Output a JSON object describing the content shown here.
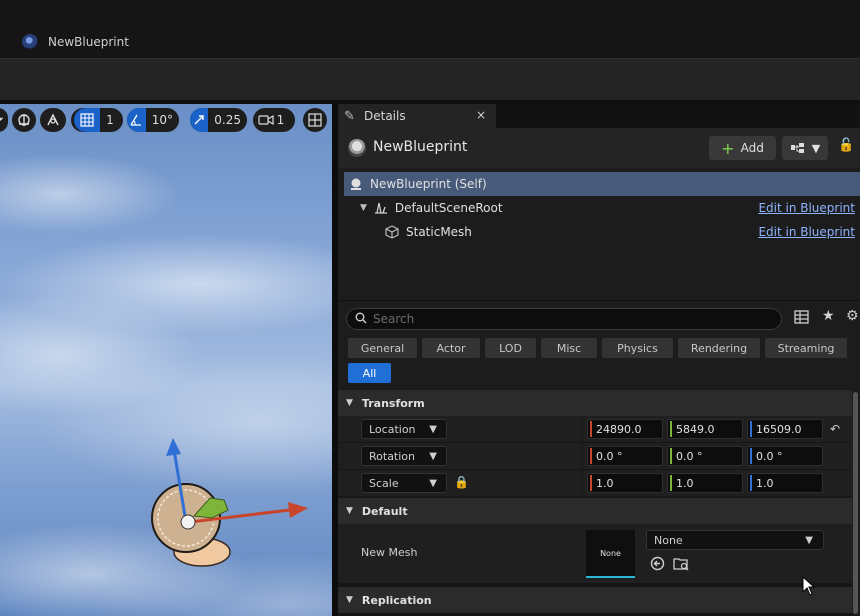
{
  "window": {
    "title": "NewBlueprint"
  },
  "viewport": {
    "grid_snap": "1",
    "angle_snap": "10°",
    "scale_snap": "0.25",
    "camera_speed": "1"
  },
  "details": {
    "tab_label": "Details",
    "tab_close": "×",
    "header_title": "NewBlueprint",
    "add_label": "Add",
    "components": [
      {
        "label": "NewBlueprint (Self)",
        "link": ""
      },
      {
        "label": "DefaultSceneRoot",
        "link": "Edit in Blueprint"
      },
      {
        "label": "StaticMesh",
        "link": "Edit in Blueprint"
      }
    ],
    "search_placeholder": "Search",
    "filters": [
      "General",
      "Actor",
      "LOD",
      "Misc",
      "Physics",
      "Rendering",
      "Streaming",
      "All"
    ],
    "active_filter": "All",
    "sections": {
      "transform": "Transform",
      "default": "Default",
      "replication": "Replication"
    },
    "transform": {
      "location": {
        "label": "Location",
        "x": "24890.0",
        "y": "5849.0",
        "z": "16509.0"
      },
      "rotation": {
        "label": "Rotation",
        "x": "0.0 °",
        "y": "0.0 °",
        "z": "0.0 °"
      },
      "scale": {
        "label": "Scale",
        "x": "1.0",
        "y": "1.0",
        "z": "1.0"
      }
    },
    "new_mesh": {
      "label": "New Mesh",
      "thumb_text": "None",
      "value": "None"
    }
  },
  "colors": {
    "axis_x": "#c8452c",
    "axis_y": "#7fb43a",
    "axis_z": "#2f6fd6",
    "accent": "#1f6fd6",
    "link": "#8eb4ff"
  }
}
